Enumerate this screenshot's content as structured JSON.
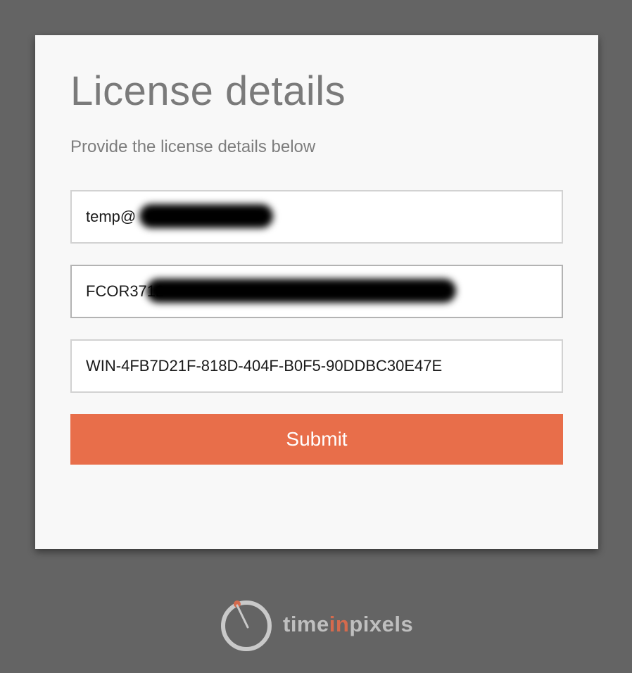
{
  "form": {
    "title": "License details",
    "subtitle": "Provide the license details below",
    "email_value": "temp@",
    "license_key_value": "FCOR3712",
    "machine_id_value": "WIN-4FB7D21F-818D-404F-B0F5-90DDBC30E47E",
    "submit_label": "Submit"
  },
  "footer": {
    "logo_icon": "stopwatch-icon",
    "brand_part1": "time",
    "brand_part2": "in",
    "brand_part3": "pixels"
  },
  "colors": {
    "background": "#646464",
    "card": "#f8f8f8",
    "accent": "#e86e4a",
    "title": "#7a7a7a",
    "logo_gray": "#bfbfbf"
  }
}
